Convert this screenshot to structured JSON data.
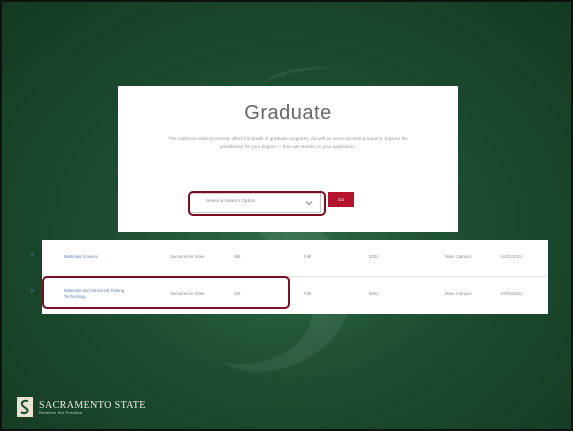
{
  "card": {
    "title": "Graduate",
    "description": "The California State University offers hundreds of graduate programs, as well as some doctoral programs. Explore the possibilities for your degree — then get started on your application.",
    "select": {
      "value": "Select a Search Option",
      "options": [
        "Select a Search Option"
      ]
    },
    "go_label": "Go"
  },
  "table": {
    "rows": [
      {
        "program": "Materials Science",
        "campus": "Sacramento State",
        "degree": "MS",
        "term": "Fall",
        "year": "2021",
        "location": "Main Campus",
        "deadline": "04/01/2021"
      },
      {
        "program": "Materials and Structural Testing Technology",
        "campus": "Sacramento State",
        "degree": "MS",
        "term": "Fall",
        "year": "2021",
        "location": "Main Campus",
        "deadline": "04/01/2021"
      }
    ]
  },
  "footer": {
    "logo_text": "SACRAMENTO STATE",
    "logo_sub": "Redefine the Possible"
  },
  "colors": {
    "background_green": "#1d4d30",
    "accent_red": "#b5122d",
    "highlight_border": "#7a1022"
  },
  "icons": {
    "select_chevron": "chevron-down-icon",
    "row_expand": "plus-icon",
    "logo": "sac-state-hornet-logo"
  }
}
